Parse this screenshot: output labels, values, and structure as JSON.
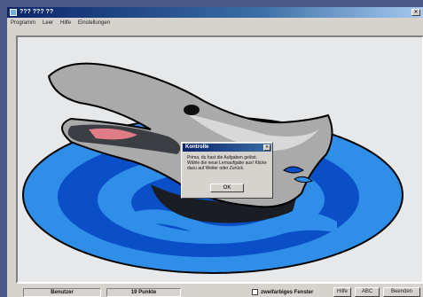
{
  "window": {
    "title": "??? ??? ??",
    "close_glyph": "✕"
  },
  "menu": {
    "items": [
      "Programm",
      "Leer",
      "Hilfe",
      "Einstellungen"
    ]
  },
  "dialog": {
    "title": "Kontrolle",
    "close_glyph": "✕",
    "message": "Prima, du hast die Aufgaben gelöst. Wähle die neue Lernaufgabe aus! Klicke dazu auf Weiter oder Zurück.",
    "ok_label": "OK"
  },
  "status": {
    "user": "Benutzer",
    "points": "19 Punkte",
    "checkbox_label": "zweifarbiges Fenster",
    "btn_hilfe": "Hilfe",
    "btn_abc": "ABC",
    "btn_end": "Beenden"
  },
  "colors": {
    "water_light": "#2f8ee8",
    "water_dark": "#0a4fc7",
    "dolphin_gray": "#a9aaa9",
    "dolphin_dark": "#3b3e43",
    "mouth_pink": "#e07c86",
    "background": "#e6e8ea"
  }
}
